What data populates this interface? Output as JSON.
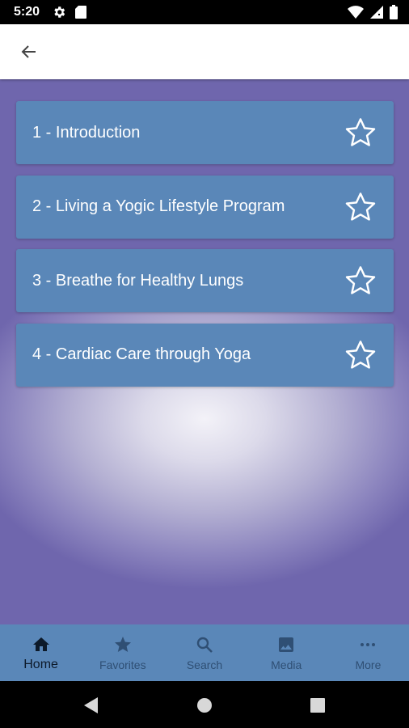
{
  "status_bar": {
    "time": "5:20",
    "icons": [
      "gear-icon",
      "sd-card-icon",
      "wifi-icon",
      "signal-icon",
      "battery-icon"
    ]
  },
  "app_bar": {
    "back_icon": "arrow-left-icon"
  },
  "list": {
    "items": [
      {
        "label": "1 - Introduction",
        "icon": "star-outline-icon"
      },
      {
        "label": "2 - Living a Yogic Lifestyle Program",
        "icon": "star-outline-icon"
      },
      {
        "label": "3 - Breathe for Healthy Lungs",
        "icon": "star-outline-icon"
      },
      {
        "label": "4 - Cardiac Care through Yoga",
        "icon": "star-outline-icon"
      }
    ]
  },
  "bottom_nav": {
    "active": "Home",
    "items": [
      {
        "label": "Home",
        "icon": "home-icon"
      },
      {
        "label": "Favorites",
        "icon": "star-icon"
      },
      {
        "label": "Search",
        "icon": "search-icon"
      },
      {
        "label": "Media",
        "icon": "image-icon"
      },
      {
        "label": "More",
        "icon": "more-horizontal-icon"
      }
    ]
  },
  "system_nav": {
    "icons": [
      "back-triangle-icon",
      "home-circle-icon",
      "recents-square-icon"
    ]
  },
  "colors": {
    "card": "#5a87b8",
    "nav_bg": "#5a87b8",
    "content_bg": "#6f66ad",
    "nav_label": "#2f4f74",
    "nav_label_active": "#0d1a2a"
  }
}
